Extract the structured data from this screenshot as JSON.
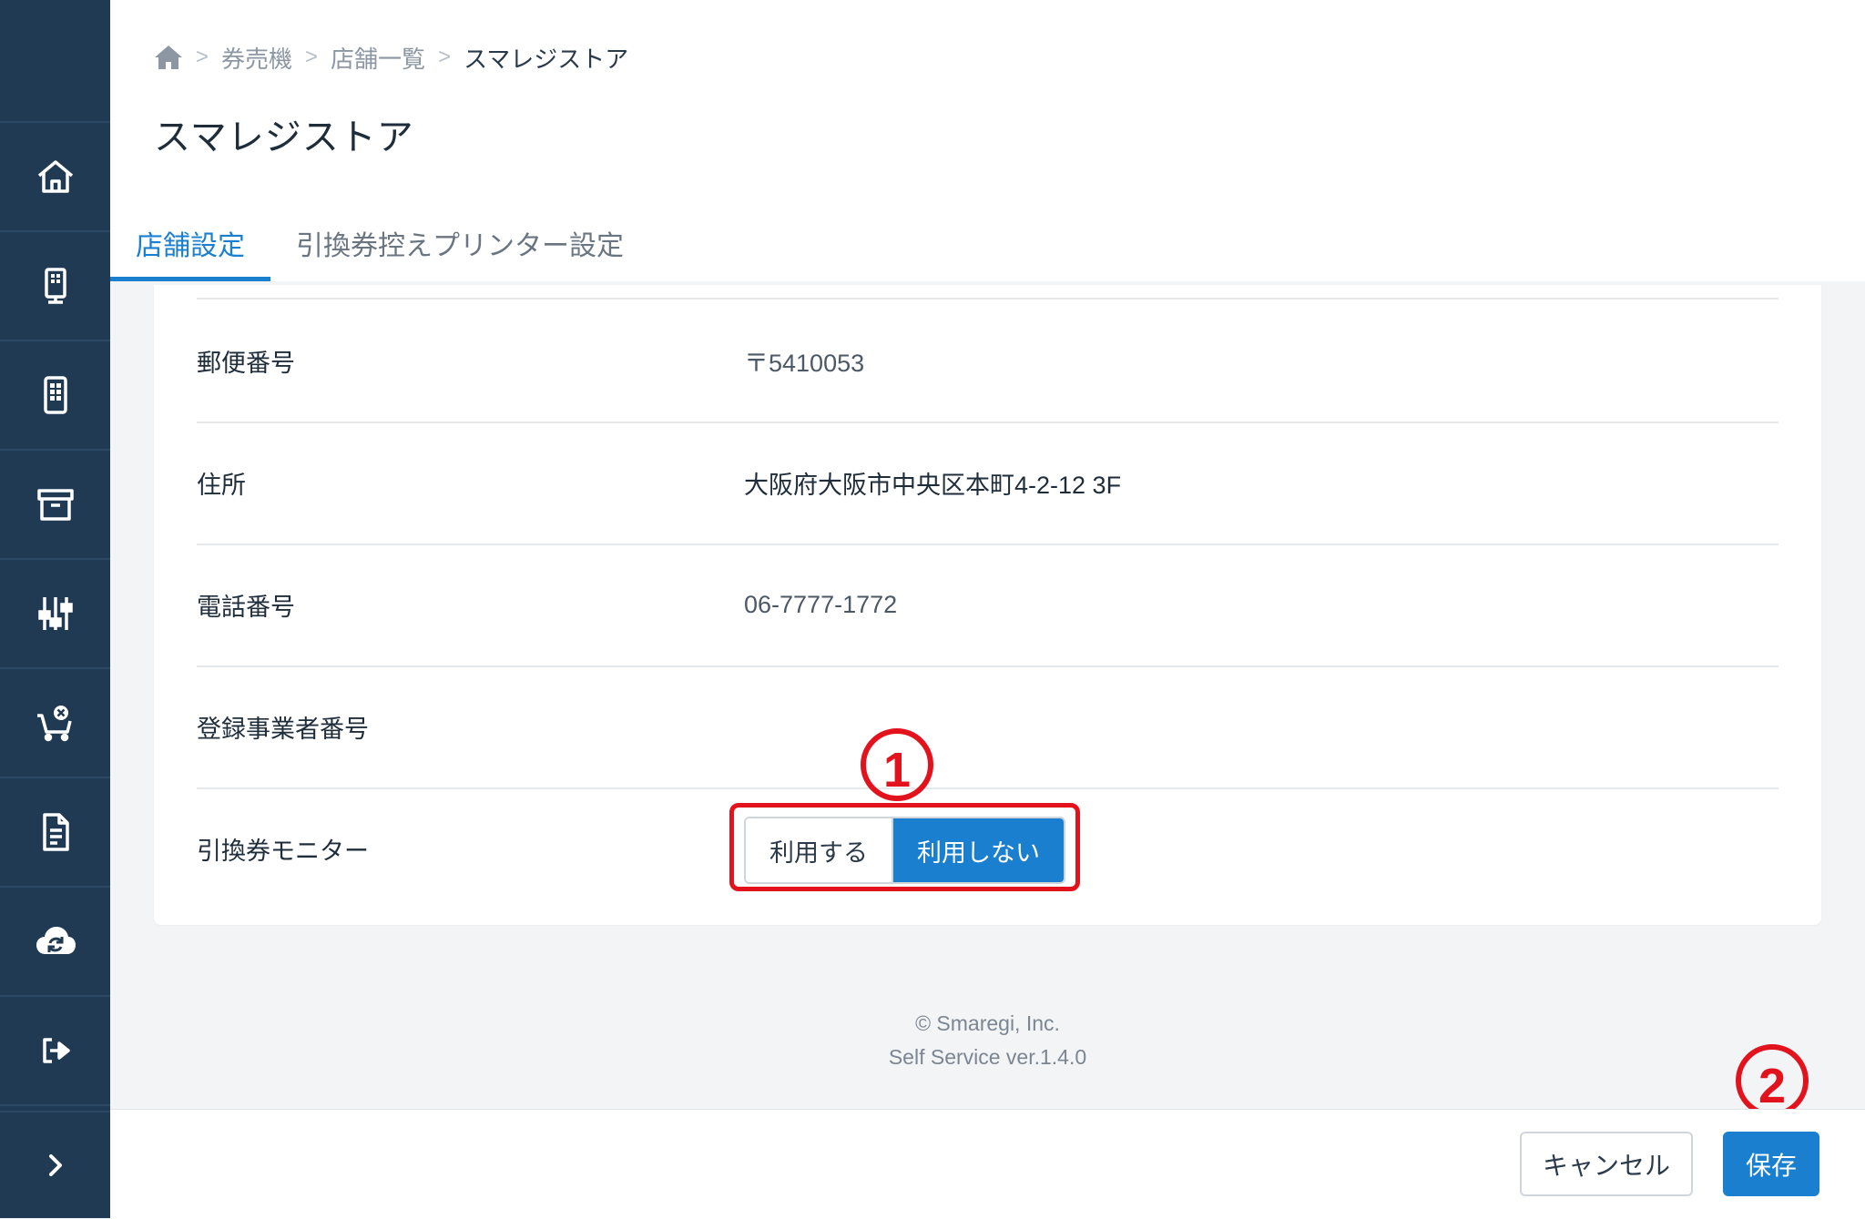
{
  "breadcrumb": {
    "home_icon": "home-icon",
    "items": [
      "券売機",
      "店舗一覧"
    ],
    "current": "スマレジストア"
  },
  "page_title": "スマレジストア",
  "tabs": [
    {
      "label": "店舗設定",
      "active": true
    },
    {
      "label": "引換券控えプリンター設定",
      "active": false
    }
  ],
  "sidebar": {
    "items": [
      {
        "icon": "home-icon"
      },
      {
        "icon": "kiosk-icon"
      },
      {
        "icon": "tablet-icon"
      },
      {
        "icon": "archive-icon"
      },
      {
        "icon": "sliders-icon"
      },
      {
        "icon": "cart-cancel-icon"
      },
      {
        "icon": "document-icon"
      },
      {
        "icon": "cloud-sync-icon"
      },
      {
        "icon": "logout-icon"
      }
    ],
    "expand_icon": "chevron-right-icon"
  },
  "form": {
    "rows": [
      {
        "label": "郵便番号",
        "value": "〒5410053"
      },
      {
        "label": "住所",
        "value": "大阪府大阪市中央区本町4-2-12 3F"
      },
      {
        "label": "電話番号",
        "value": "06-7777-1772"
      },
      {
        "label": "登録事業者番号",
        "value": ""
      },
      {
        "label": "引換券モニター"
      }
    ],
    "monitor_toggle": {
      "options": [
        "利用する",
        "利用しない"
      ],
      "selected": "利用しない"
    }
  },
  "annotations": {
    "marker_1": "1",
    "marker_2": "2",
    "color": "#e3131e"
  },
  "footer": {
    "copyright": "© Smaregi, Inc.",
    "version": "Self Service ver.1.4.0"
  },
  "actions": {
    "cancel_label": "キャンセル",
    "save_label": "保存"
  },
  "colors": {
    "sidebar": "#1f3a52",
    "accent": "#1a7fce"
  }
}
